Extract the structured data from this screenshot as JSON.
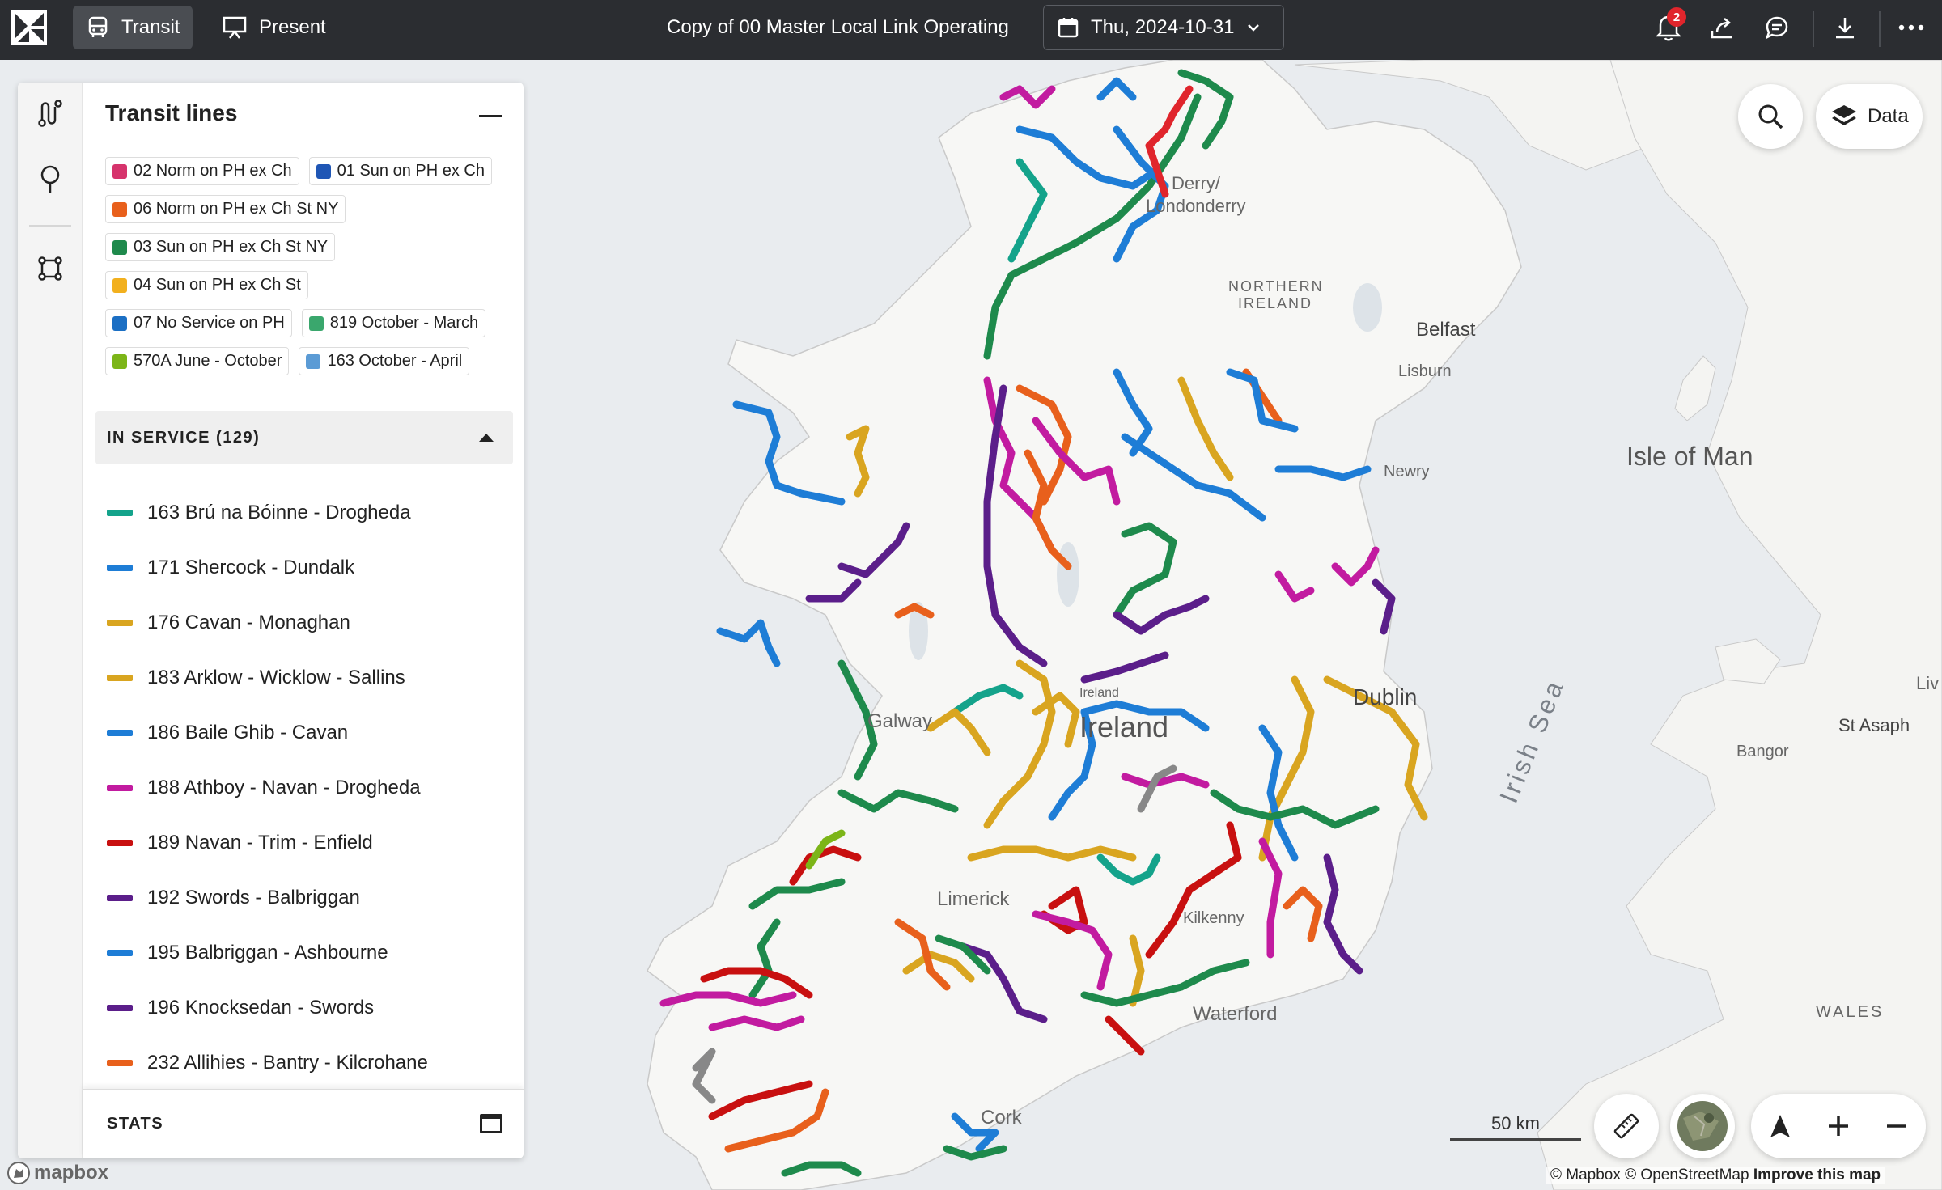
{
  "topbar": {
    "modes": [
      {
        "label": "Transit",
        "icon": "bus-icon",
        "active": true
      },
      {
        "label": "Present",
        "icon": "presentation-icon",
        "active": false
      }
    ],
    "title": "Copy of 00 Master Local Link Operating",
    "date": "Thu, 2024-10-31",
    "notification_count": "2",
    "icons": [
      "bell-icon",
      "share-icon",
      "comment-icon",
      "download-icon",
      "more-icon"
    ]
  },
  "panel": {
    "title": "Transit lines",
    "legend": [
      [
        {
          "label": "02 Norm on PH ex Ch",
          "color": "#d6336c"
        },
        {
          "label": "01 Sun on PH ex Ch",
          "color": "#1f56b5"
        }
      ],
      [
        {
          "label": "06 Norm on PH ex Ch St NY",
          "color": "#e8601c"
        }
      ],
      [
        {
          "label": "03 Sun on PH ex Ch St NY",
          "color": "#1e8a4c"
        }
      ],
      [
        {
          "label": "04 Sun on PH ex Ch St",
          "color": "#f2b01e"
        }
      ],
      [
        {
          "label": "07 No Service on PH",
          "color": "#1b6fc4"
        },
        {
          "label": "819 October - March",
          "color": "#3aa76d"
        }
      ],
      [
        {
          "label": "570A June - October",
          "color": "#7cb518"
        },
        {
          "label": "163 October - April",
          "color": "#5b9bd5"
        }
      ]
    ],
    "in_service": "IN SERVICE (129)",
    "lines": [
      {
        "label": "163 Brú na Bóinne - Drogheda",
        "color": "#14a38b"
      },
      {
        "label": "171 Shercock - Dundalk",
        "color": "#1e7dd6"
      },
      {
        "label": "176 Cavan - Monaghan",
        "color": "#d9a520"
      },
      {
        "label": "183 Arklow - Wicklow - Sallins",
        "color": "#d9a520"
      },
      {
        "label": "186 Baile Ghib - Cavan",
        "color": "#1e7dd6"
      },
      {
        "label": "188 Athboy - Navan - Drogheda",
        "color": "#c21ba0"
      },
      {
        "label": "189 Navan - Trim - Enfield",
        "color": "#c81010"
      },
      {
        "label": "192 Swords - Balbriggan",
        "color": "#5b1e8a"
      },
      {
        "label": "195 Balbriggan - Ashbourne",
        "color": "#1e7dd6"
      },
      {
        "label": "196 Knocksedan - Swords",
        "color": "#5b1e8a"
      },
      {
        "label": "232 Allihies - Bantry - Kilcrohane",
        "color": "#e8601c"
      }
    ],
    "stats": "STATS"
  },
  "map": {
    "labels": [
      {
        "text": "Derry/"
      },
      {
        "text": "Londonderry"
      },
      {
        "text": "NORTHERN"
      },
      {
        "text": "IRELAND"
      },
      {
        "text": "Belfast"
      },
      {
        "text": "Lisburn"
      },
      {
        "text": "Newry"
      },
      {
        "text": "Isle of Man"
      },
      {
        "text": "Dublin"
      },
      {
        "text": "Ireland"
      },
      {
        "text": "Ireland"
      },
      {
        "text": "Galway"
      },
      {
        "text": "Limerick"
      },
      {
        "text": "Kilkenny"
      },
      {
        "text": "Waterford"
      },
      {
        "text": "Cork"
      },
      {
        "text": "Irish Sea"
      },
      {
        "text": "Bangor"
      },
      {
        "text": "St Asaph"
      },
      {
        "text": "Liv"
      },
      {
        "text": "WALES"
      }
    ],
    "data_button": "Data",
    "scale": "50 km",
    "attribution_plain": "© Mapbox © OpenStreetMap",
    "attribution_link": "Improve this map",
    "mapbox": "mapbox"
  }
}
